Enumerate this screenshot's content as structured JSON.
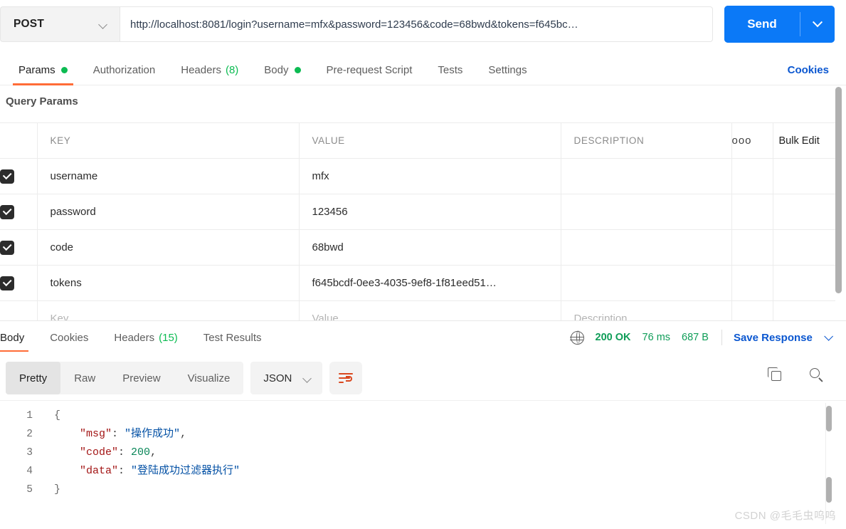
{
  "request": {
    "method": "POST",
    "method_caret_icon": "chevron-down-icon",
    "url": "http://localhost:8081/login?username=mfx&password=123456&code=68bwd&tokens=f645bc…",
    "url_placeholder": "Enter request URL",
    "send_label": "Send",
    "send_caret_icon": "chevron-down-icon"
  },
  "request_tabs": {
    "items": [
      {
        "label": "Params",
        "active": true,
        "dot": true,
        "count": ""
      },
      {
        "label": "Authorization",
        "active": false,
        "dot": false,
        "count": ""
      },
      {
        "label": "Headers",
        "active": false,
        "dot": false,
        "count": "(8)"
      },
      {
        "label": "Body",
        "active": false,
        "dot": true,
        "count": ""
      },
      {
        "label": "Pre-request Script",
        "active": false,
        "dot": false,
        "count": ""
      },
      {
        "label": "Tests",
        "active": false,
        "dot": false,
        "count": ""
      },
      {
        "label": "Settings",
        "active": false,
        "dot": false,
        "count": ""
      }
    ],
    "cookies_label": "Cookies"
  },
  "query_params": {
    "section_title": "Query Params",
    "columns": [
      "KEY",
      "VALUE",
      "DESCRIPTION"
    ],
    "more_icon": "ooo",
    "bulk_edit_label": "Bulk Edit",
    "rows": [
      {
        "checked": true,
        "key": "username",
        "value": "mfx",
        "description": ""
      },
      {
        "checked": true,
        "key": "password",
        "value": "123456",
        "description": ""
      },
      {
        "checked": true,
        "key": "code",
        "value": "68bwd",
        "description": ""
      },
      {
        "checked": true,
        "key": "tokens",
        "value": "f645bcdf-0ee3-4035-9ef8-1f81eed51…",
        "description": ""
      }
    ],
    "placeholder_row": {
      "key": "Key",
      "value": "Value",
      "description": "Description"
    }
  },
  "response_tabs": {
    "items": [
      {
        "label": "Body",
        "active": true,
        "count": ""
      },
      {
        "label": "Cookies",
        "active": false,
        "count": ""
      },
      {
        "label": "Headers",
        "active": false,
        "count": "(15)"
      },
      {
        "label": "Test Results",
        "active": false,
        "count": ""
      }
    ],
    "globe_icon": "globe-icon",
    "status": "200 OK",
    "time": "76 ms",
    "size": "687 B",
    "save_response_label": "Save Response",
    "save_caret_icon": "chevron-down-icon",
    "status_color": "#0f9d58",
    "link_color": "#0b57d0"
  },
  "body_toolbar": {
    "views": [
      {
        "label": "Pretty",
        "active": true
      },
      {
        "label": "Raw",
        "active": false
      },
      {
        "label": "Preview",
        "active": false
      },
      {
        "label": "Visualize",
        "active": false
      }
    ],
    "format": "JSON",
    "format_caret_icon": "chevron-down-icon",
    "wrap_icon": "word-wrap-icon",
    "copy_icon": "copy-icon",
    "search_icon": "search-icon"
  },
  "response_body": {
    "line_numbers": [
      "1",
      "2",
      "3",
      "4",
      "5"
    ],
    "lines": [
      {
        "indent": 0,
        "tokens": [
          {
            "t": "brace",
            "v": "{"
          }
        ]
      },
      {
        "indent": 1,
        "tokens": [
          {
            "t": "key",
            "v": "\"msg\""
          },
          {
            "t": "pun",
            "v": ": "
          },
          {
            "t": "str",
            "v": "\"操作成功\""
          },
          {
            "t": "pun",
            "v": ","
          }
        ]
      },
      {
        "indent": 1,
        "tokens": [
          {
            "t": "key",
            "v": "\"code\""
          },
          {
            "t": "pun",
            "v": ": "
          },
          {
            "t": "num",
            "v": "200"
          },
          {
            "t": "pun",
            "v": ","
          }
        ]
      },
      {
        "indent": 1,
        "tokens": [
          {
            "t": "key",
            "v": "\"data\""
          },
          {
            "t": "pun",
            "v": ": "
          },
          {
            "t": "str",
            "v": "\"登陆成功过滤器执行\""
          }
        ]
      },
      {
        "indent": 0,
        "tokens": [
          {
            "t": "brace",
            "v": "}"
          }
        ]
      }
    ]
  },
  "watermark": "CSDN @毛毛虫呜呜"
}
